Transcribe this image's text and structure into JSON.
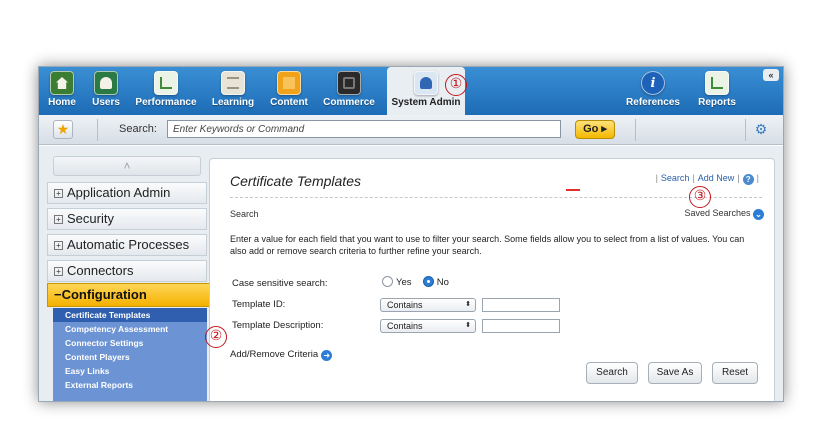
{
  "nav": {
    "items": [
      {
        "label": "Home",
        "icon": "home-icon",
        "color": "#3a7d33"
      },
      {
        "label": "Users",
        "icon": "users-icon",
        "color": "#2c7a43"
      },
      {
        "label": "Performance",
        "icon": "performance-icon",
        "color": "#3f8b3a"
      },
      {
        "label": "Learning",
        "icon": "learning-icon",
        "color": "#e7e3d6"
      },
      {
        "label": "Content",
        "icon": "content-icon",
        "color": "#f0a21a"
      },
      {
        "label": "Commerce",
        "icon": "commerce-icon",
        "color": "#2a2a2a"
      },
      {
        "label": "System Admin",
        "icon": "system-admin-icon",
        "color": "#3066b4"
      },
      {
        "label": "References",
        "icon": "references-icon",
        "color": "#1d62b8"
      },
      {
        "label": "Reports",
        "icon": "reports-icon",
        "color": "#3f8b3a"
      }
    ],
    "active": "System Admin",
    "collapse_glyph": "«"
  },
  "toolbar": {
    "search_label": "Search:",
    "command_value": "Enter Keywords or Command",
    "go_label": "Go ▸",
    "star_glyph": "★",
    "gear_glyph": "⚙"
  },
  "sidebar": {
    "scroll_glyph": "˄",
    "items": [
      {
        "label": "Application Admin"
      },
      {
        "label": "Security"
      },
      {
        "label": "Automatic Processes"
      },
      {
        "label": "Connectors"
      }
    ],
    "active": {
      "label": "Configuration"
    },
    "subitems": [
      "Certificate Templates",
      "Competency Assessment",
      "Connector Settings",
      "Content Players",
      "Easy Links",
      "External Reports"
    ]
  },
  "main": {
    "title": "Certificate Templates",
    "links": {
      "search": "Search",
      "add_new": "Add New",
      "help": "?"
    },
    "section": "Search",
    "saved_searches": "Saved Searches",
    "instructions": "Enter a value for each field that you want to use to filter your search. Some fields allow you to select from a list of values. You can also add or remove search criteria to further refine your search.",
    "case_label": "Case sensitive search:",
    "yes": "Yes",
    "no": "No",
    "case_value": "No",
    "template_id_label": "Template ID:",
    "template_desc_label": "Template Description:",
    "operator": "Contains",
    "add_remove": "Add/Remove Criteria",
    "buttons": {
      "search": "Search",
      "save_as": "Save As",
      "reset": "Reset"
    }
  },
  "callouts": [
    "①",
    "②",
    "③"
  ],
  "colors": {
    "nav_bar": "#2a7fcb",
    "active_tab": "#e9eef3",
    "config_highlight": "#f4b100",
    "sub_nav": "#6c93d4",
    "callout": "#c0181f"
  }
}
